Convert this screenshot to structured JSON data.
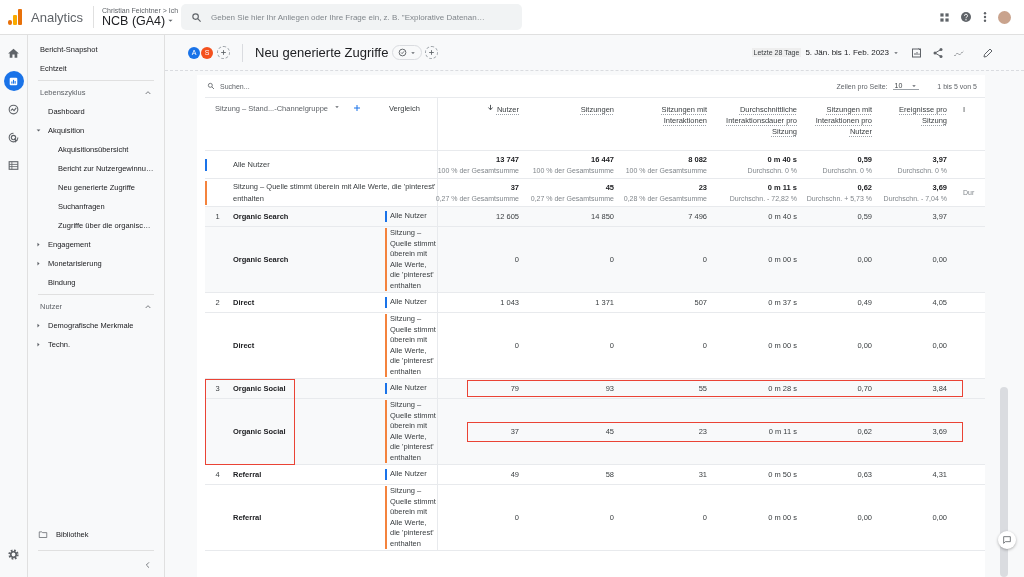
{
  "app": {
    "name": "Analytics",
    "account_path": "Christian Feichtner > Ich",
    "property": "NCB (GA4)"
  },
  "search": {
    "placeholder": "Geben Sie hier Ihr Anliegen oder Ihre Frage ein, z. B. \"Explorative Datenan…"
  },
  "rail": [
    {
      "selected": false
    },
    {
      "selected": true
    },
    {
      "selected": false
    },
    {
      "selected": false
    },
    {
      "selected": false
    }
  ],
  "sidebar": {
    "top_items": [
      "Bericht-Snapshot",
      "Echtzeit"
    ],
    "sections": [
      {
        "title": "Lebenszyklus",
        "expanded": true,
        "items": [
          {
            "kind": "link",
            "label": "Dashboard"
          },
          {
            "kind": "group",
            "label": "Akquisition",
            "expanded": true,
            "children": [
              {
                "label": "Akquisitionsübersicht"
              },
              {
                "label": "Bericht zur Nutzergewinnu…"
              },
              {
                "label": "Neu generierte Zugriffe"
              },
              {
                "label": "Suchanfragen"
              },
              {
                "label": "Zugriffe über die organisc…"
              }
            ]
          },
          {
            "kind": "group",
            "label": "Engagement",
            "expanded": false
          },
          {
            "kind": "group",
            "label": "Monetarisierung",
            "expanded": false
          },
          {
            "kind": "link",
            "label": "Bindung"
          }
        ]
      },
      {
        "title": "Nutzer",
        "expanded": true,
        "items": [
          {
            "kind": "group",
            "label": "Demografische Merkmale",
            "expanded": false
          },
          {
            "kind": "group",
            "label": "Techn.",
            "expanded": false
          }
        ]
      }
    ],
    "library": "Bibliothek"
  },
  "report": {
    "segments": [
      {
        "letter": "A",
        "color": "#1a73e8"
      },
      {
        "letter": "S",
        "color": "#f4511e"
      }
    ],
    "title": "Neu generierte Zugriffe",
    "date_label": "Letzte 28 Tage",
    "date_range": "5. Jän. bis 1. Feb. 2023"
  },
  "table": {
    "search_placeholder": "Suchen...",
    "rows_per_page_label": "Zeilen pro Seite:",
    "rows_per_page": "10",
    "pagination": "1 bis 5 von 5",
    "dimension_header": "Sitzung – Stand...-Channelgruppe",
    "comparison_header": "Vergleich",
    "columns": [
      {
        "label": "Nutzer",
        "sorted": true
      },
      {
        "label": "Sitzungen",
        "sorted": false
      },
      {
        "label": "Sitzungen mit Interaktionen",
        "sorted": false
      },
      {
        "label": "Durchschnittliche Interaktionsdauer pro Sitzung",
        "sorted": false
      },
      {
        "label": "Sitzungen mit Interaktionen pro Nutzer",
        "sorted": false
      },
      {
        "label": "Ereignisse pro Sitzung",
        "sorted": false
      },
      {
        "label": "I",
        "sorted": false
      }
    ],
    "totals": [
      {
        "label": "Alle Nutzer",
        "color": "#1a73e8",
        "values": [
          {
            "value": "13 747",
            "note": "100 % der Gesamtsumme"
          },
          {
            "value": "16 447",
            "note": "100 % der Gesamtsumme"
          },
          {
            "value": "8 082",
            "note": "100 % der Gesamtsumme"
          },
          {
            "value": "0 m 40 s",
            "note": "Durchschn. 0 %"
          },
          {
            "value": "0,59",
            "note": "Durchschn. 0 %"
          },
          {
            "value": "3,97",
            "note": "Durchschn. 0 %"
          }
        ]
      },
      {
        "label": "Sitzung – Quelle stimmt überein mit Alle Werte, die 'pinterest' enthalten",
        "color": "#f4833d",
        "values": [
          {
            "value": "37",
            "note": "0,27 % der Gesamtsumme"
          },
          {
            "value": "45",
            "note": "0,27 % der Gesamtsumme"
          },
          {
            "value": "23",
            "note": "0,28 % der Gesamtsumme"
          },
          {
            "value": "0 m 11 s",
            "note": "Durchschn. - 72,82 %"
          },
          {
            "value": "0,62",
            "note": "Durchschn. + 5,73 %"
          },
          {
            "value": "3,69",
            "note": "Durchschn. - 7,04 %"
          },
          {
            "note": "Dur"
          }
        ]
      }
    ],
    "groups": [
      {
        "index": "1",
        "highlighted": false,
        "rows": [
          {
            "name": "Organic Search",
            "segment": "Alle Nutzer",
            "color": "#1a73e8",
            "values": [
              "12 605",
              "14 850",
              "7 496",
              "0 m 40 s",
              "0,59",
              "3,97"
            ]
          },
          {
            "name": "Organic Search",
            "segment": "Sitzung – Quelle stimmt überein mit Alle Werte, die 'pinterest' enthalten",
            "color": "#f4833d",
            "values": [
              "0",
              "0",
              "0",
              "0 m 00 s",
              "0,00",
              "0,00"
            ]
          }
        ]
      },
      {
        "index": "2",
        "highlighted": false,
        "rows": [
          {
            "name": "Direct",
            "segment": "Alle Nutzer",
            "color": "#1a73e8",
            "values": [
              "1 043",
              "1 371",
              "507",
              "0 m 37 s",
              "0,49",
              "4,05"
            ]
          },
          {
            "name": "Direct",
            "segment": "Sitzung – Quelle stimmt überein mit Alle Werte, die 'pinterest' enthalten",
            "color": "#f4833d",
            "values": [
              "0",
              "0",
              "0",
              "0 m 00 s",
              "0,00",
              "0,00"
            ]
          }
        ]
      },
      {
        "index": "3",
        "highlighted": true,
        "rows": [
          {
            "name": "Organic Social",
            "segment": "Alle Nutzer",
            "color": "#1a73e8",
            "values": [
              "79",
              "93",
              "55",
              "0 m 28 s",
              "0,70",
              "3,84"
            ]
          },
          {
            "name": "Organic Social",
            "segment": "Sitzung – Quelle stimmt überein mit Alle Werte, die 'pinterest' enthalten",
            "color": "#f4833d",
            "values": [
              "37",
              "45",
              "23",
              "0 m 11 s",
              "0,62",
              "3,69"
            ]
          }
        ]
      },
      {
        "index": "4",
        "highlighted": false,
        "rows": [
          {
            "name": "Referral",
            "segment": "Alle Nutzer",
            "color": "#1a73e8",
            "values": [
              "49",
              "58",
              "31",
              "0 m 50 s",
              "0,63",
              "4,31"
            ]
          },
          {
            "name": "Referral",
            "segment": "Sitzung – Quelle stimmt überein mit Alle Werte, die 'pinterest' enthalten",
            "color": "#f4833d",
            "values": [
              "0",
              "0",
              "0",
              "0 m 00 s",
              "0,00",
              "0,00"
            ]
          }
        ]
      }
    ]
  }
}
